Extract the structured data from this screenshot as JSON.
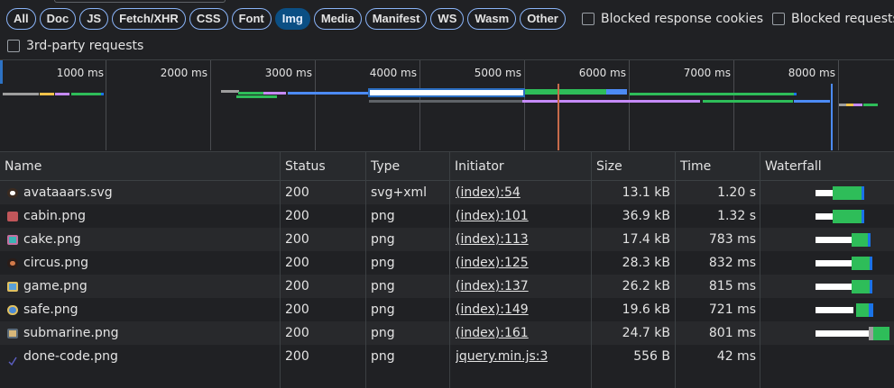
{
  "filters": {
    "chips": [
      {
        "label": "All",
        "active": false
      },
      {
        "label": "Doc",
        "active": false
      },
      {
        "label": "JS",
        "active": false
      },
      {
        "label": "Fetch/XHR",
        "active": false
      },
      {
        "label": "CSS",
        "active": false
      },
      {
        "label": "Font",
        "active": false
      },
      {
        "label": "Img",
        "active": true
      },
      {
        "label": "Media",
        "active": false
      },
      {
        "label": "Manifest",
        "active": false
      },
      {
        "label": "WS",
        "active": false
      },
      {
        "label": "Wasm",
        "active": false
      },
      {
        "label": "Other",
        "active": false
      }
    ],
    "blocked_cookies_label": "Blocked response cookies",
    "blocked_requests_label": "Blocked requests",
    "third_party_label": "3rd-party requests"
  },
  "overview": {
    "ticks": [
      "1000 ms",
      "2000 ms",
      "3000 ms",
      "4000 ms",
      "5000 ms",
      "6000 ms",
      "7000 ms",
      "8000 ms"
    ]
  },
  "table": {
    "columns": [
      "Name",
      "Status",
      "Type",
      "Initiator",
      "Size",
      "Time",
      "Waterfall"
    ],
    "rows": [
      {
        "name": "avataaars.svg",
        "icon": "avatar-thumbnail-icon",
        "thumb_color": "#e8d7c8",
        "status": "200",
        "type": "svg+xml",
        "initiator": "(index):54",
        "size": "13.1 kB",
        "time": "1.20 s"
      },
      {
        "name": "cabin.png",
        "icon": "cabin-thumbnail-icon",
        "thumb_color": "#c0565a",
        "status": "200",
        "type": "png",
        "initiator": "(index):101",
        "size": "36.9 kB",
        "time": "1.32 s"
      },
      {
        "name": "cake.png",
        "icon": "cake-thumbnail-icon",
        "thumb_color": "#3db3b5",
        "status": "200",
        "type": "png",
        "initiator": "(index):113",
        "size": "17.4 kB",
        "time": "783 ms"
      },
      {
        "name": "circus.png",
        "icon": "circus-thumbnail-icon",
        "thumb_color": "#d27a4a",
        "status": "200",
        "type": "png",
        "initiator": "(index):125",
        "size": "28.3 kB",
        "time": "832 ms"
      },
      {
        "name": "game.png",
        "icon": "game-thumbnail-icon",
        "thumb_color": "#5aa0d8",
        "status": "200",
        "type": "png",
        "initiator": "(index):137",
        "size": "26.2 kB",
        "time": "815 ms"
      },
      {
        "name": "safe.png",
        "icon": "safe-thumbnail-icon",
        "thumb_color": "#4c8bd6",
        "status": "200",
        "type": "png",
        "initiator": "(index):149",
        "size": "19.6 kB",
        "time": "721 ms"
      },
      {
        "name": "submarine.png",
        "icon": "submarine-thumbnail-icon",
        "thumb_color": "#d8b87a",
        "status": "200",
        "type": "png",
        "initiator": "(index):161",
        "size": "24.7 kB",
        "time": "801 ms"
      },
      {
        "name": "done-code.png",
        "icon": "checkmark-icon",
        "thumb_color": "#5c5fc4",
        "status": "200",
        "type": "png",
        "initiator": "jquery.min.js:3",
        "size": "556 B",
        "time": "42 ms"
      }
    ]
  }
}
